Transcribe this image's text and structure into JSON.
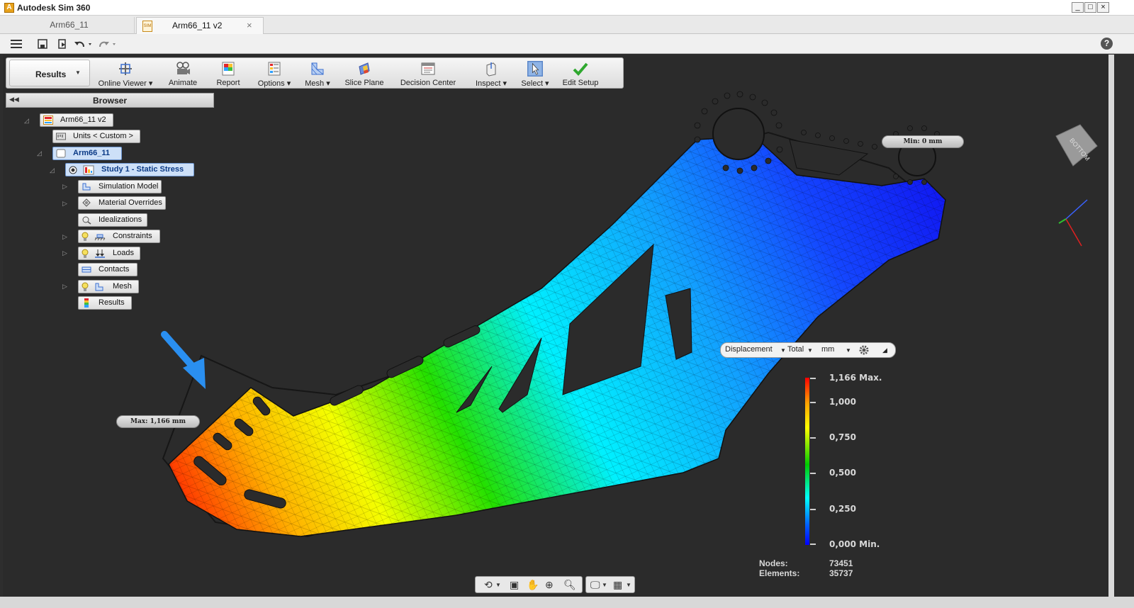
{
  "window": {
    "title": "Autodesk Sim 360",
    "icon": "autodesk-app-icon",
    "controls": [
      "_",
      "□",
      "×"
    ]
  },
  "tabs": [
    {
      "label": "Arm66_11",
      "active": false
    },
    {
      "label": "Arm66_11 v2",
      "active": true,
      "close": "×"
    }
  ],
  "ribbon": {
    "results_tab": "Results",
    "buttons": [
      {
        "id": "online-viewer",
        "label": "Online Viewer ▾",
        "icon": "online-viewer-icon"
      },
      {
        "id": "animate",
        "label": "Animate",
        "icon": "animate-icon"
      },
      {
        "id": "report",
        "label": "Report",
        "icon": "report-icon"
      },
      {
        "id": "options",
        "label": "Options ▾",
        "icon": "options-icon"
      },
      {
        "id": "mesh",
        "label": "Mesh ▾",
        "icon": "mesh-icon"
      },
      {
        "id": "slice-plane",
        "label": "Slice Plane",
        "icon": "slice-plane-icon"
      },
      {
        "id": "decision-center",
        "label": "Decision Center",
        "icon": "decision-center-icon"
      },
      {
        "id": "inspect",
        "label": "Inspect ▾",
        "icon": "inspect-icon"
      },
      {
        "id": "select",
        "label": "Select ▾",
        "icon": "select-arrow-icon"
      },
      {
        "id": "edit-setup",
        "label": "Edit Setup",
        "icon": "checkmark-icon"
      }
    ]
  },
  "browser": {
    "title": "Browser",
    "tree": [
      {
        "label": "Arm66_11 v2"
      },
      {
        "label": "Units < Custom >"
      },
      {
        "label": "Arm66_11"
      },
      {
        "label": "Study 1 - Static Stress"
      },
      {
        "label": "Simulation Model"
      },
      {
        "label": "Material Overrides"
      },
      {
        "label": "Idealizations"
      },
      {
        "label": "Constraints"
      },
      {
        "label": "Loads"
      },
      {
        "label": "Contacts"
      },
      {
        "label": "Mesh"
      },
      {
        "label": "Results"
      }
    ]
  },
  "viewport": {
    "max_callout": "Max: 1,166 mm",
    "min_callout": "Min: 0 mm",
    "result_settings": {
      "type": "Displacement",
      "component": "Total",
      "unit": "mm"
    },
    "legend": [
      {
        "label": "1,166 Max."
      },
      {
        "label": "1,000"
      },
      {
        "label": "0,750"
      },
      {
        "label": "0,500"
      },
      {
        "label": "0,250"
      },
      {
        "label": "0,000 Min."
      }
    ],
    "stats": {
      "nodes_label": "Nodes:",
      "nodes_value": "73451",
      "elements_label": "Elements:",
      "elements_value": "35737"
    },
    "viewcube_face": "BOTTOM"
  }
}
